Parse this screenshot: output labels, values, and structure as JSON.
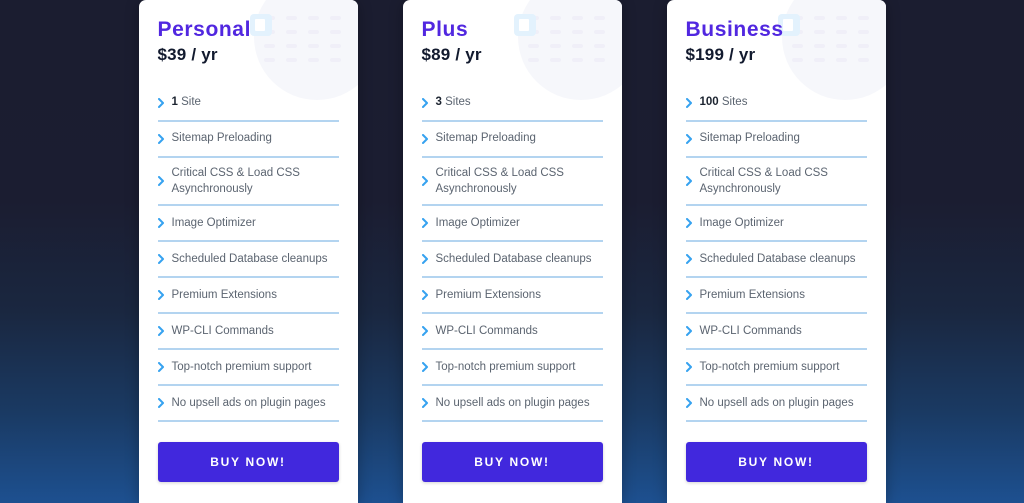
{
  "page": {
    "background_top_color": "#1b1d30",
    "background_bottom_color": "#1d5090"
  },
  "theme": {
    "plan_name_color": "#5127e0",
    "price_color": "#121a2e",
    "divider_color": "#b3d4f0",
    "chevron_color": "#36a2f0",
    "button_color": "#4128dd",
    "feature_text_color": "#5b6470"
  },
  "plans": [
    {
      "name": "Personal",
      "price": "$39 / yr",
      "sites_count": "1",
      "sites_label": " Site",
      "cta_label": "BUY NOW!",
      "features": [
        "Sitemap Preloading",
        "Critical CSS & Load CSS Asynchronously",
        "Image Optimizer",
        "Scheduled Database cleanups",
        "Premium Extensions",
        "WP-CLI Commands",
        "Top-notch premium support",
        "No upsell ads on plugin pages"
      ]
    },
    {
      "name": "Plus",
      "price": "$89 / yr",
      "sites_count": "3",
      "sites_label": " Sites",
      "cta_label": "BUY NOW!",
      "features": [
        "Sitemap Preloading",
        "Critical CSS & Load CSS Asynchronously",
        "Image Optimizer",
        "Scheduled Database cleanups",
        "Premium Extensions",
        "WP-CLI Commands",
        "Top-notch premium support",
        "No upsell ads on plugin pages"
      ]
    },
    {
      "name": "Business",
      "price": "$199 / yr",
      "sites_count": "100",
      "sites_label": " Sites",
      "cta_label": "BUY NOW!",
      "features": [
        "Sitemap Preloading",
        "Critical CSS & Load CSS Asynchronously",
        "Image Optimizer",
        "Scheduled Database cleanups",
        "Premium Extensions",
        "WP-CLI Commands",
        "Top-notch premium support",
        "No upsell ads on plugin pages"
      ]
    }
  ]
}
